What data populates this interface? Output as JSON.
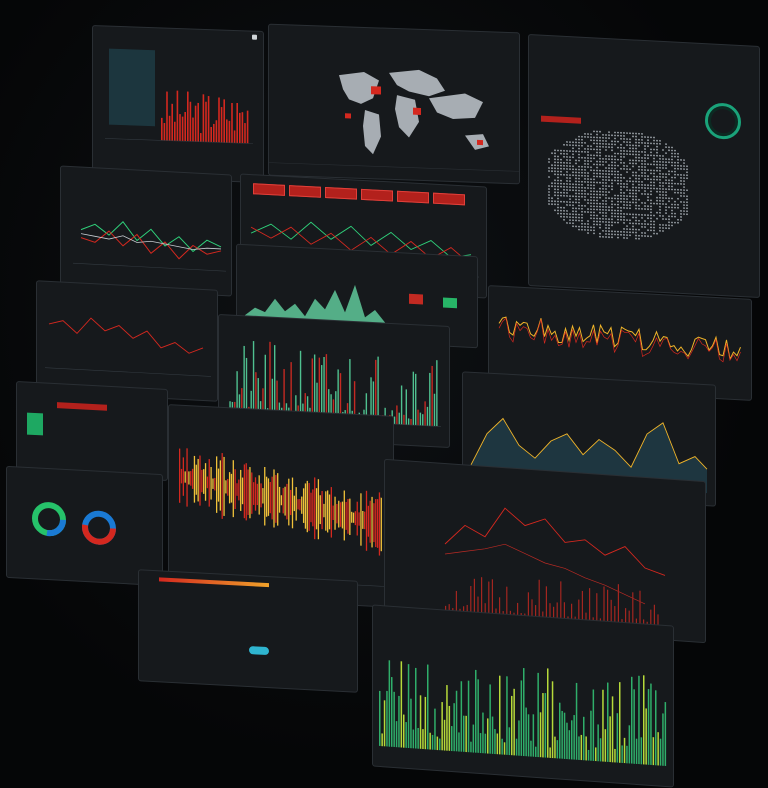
{
  "app": {
    "window_title": "",
    "accent_red": "#d4281f",
    "accent_green": "#2fd07a",
    "accent_yellow": "#f0c23a",
    "panel_bg": "#16191c"
  },
  "panels": {
    "top_left_bars": {
      "title": "",
      "chart_note": ""
    },
    "world_map": {
      "title": ""
    },
    "right_map": {
      "title": "",
      "header_label": ""
    },
    "line_multi": {
      "title": ""
    },
    "red_tabs": {
      "labels": [
        "",
        "",
        "",
        "",
        "",
        ""
      ]
    },
    "green_area": {
      "title": "",
      "buttons": [
        "",
        ""
      ]
    },
    "left_mid": {
      "title": "",
      "readout_a": "",
      "readout_b": ""
    },
    "right_yellow_line": {
      "title": ""
    },
    "right_orange_area": {
      "title": ""
    },
    "left_green_block": {
      "title": ""
    },
    "center_yellow_spiky": {
      "title": "",
      "readouts": [
        "",
        ""
      ]
    },
    "donuts": {
      "title": ""
    },
    "bottom_red_line": {
      "title": ""
    },
    "bottom_green_bars": {
      "title": ""
    }
  },
  "icons": {
    "close": "close-icon",
    "gauge": "gauge-icon",
    "toggle": "toggle-icon"
  }
}
